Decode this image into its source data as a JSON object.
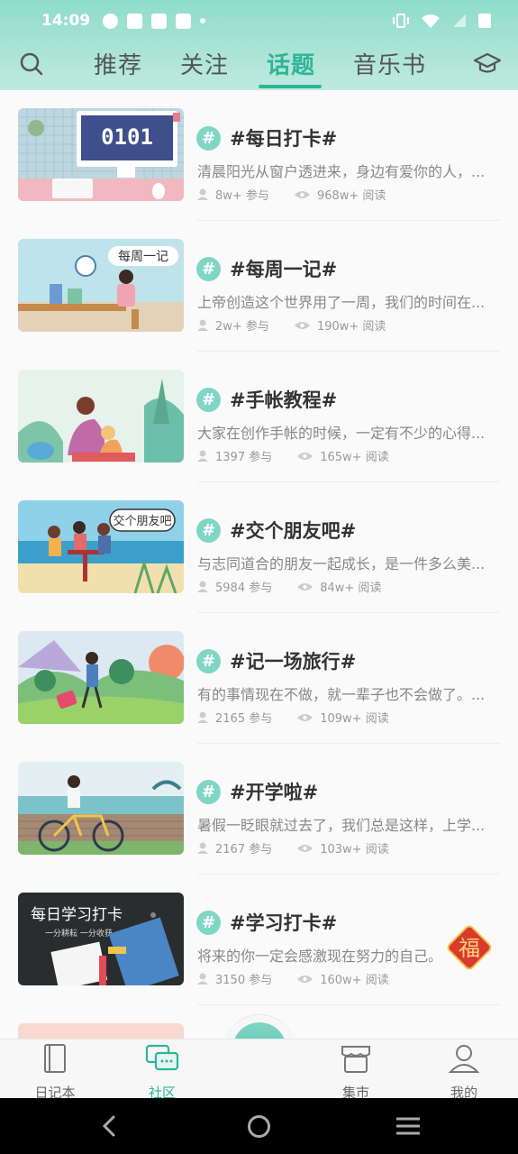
{
  "status": {
    "time": "14:09"
  },
  "nav": {
    "tabs": [
      {
        "label": "推荐"
      },
      {
        "label": "关注"
      },
      {
        "label": "话题"
      },
      {
        "label": "音乐书"
      }
    ]
  },
  "topics": [
    {
      "title": "#每日打卡#",
      "desc": "清晨阳光从窗户透进来，身边有爱你的人，...",
      "join": "8w+ 参与",
      "read": "968w+ 阅读"
    },
    {
      "title": "#每周一记#",
      "desc": "上帝创造这个世界用了一周，我们的时间在...",
      "join": "2w+ 参与",
      "read": "190w+ 阅读"
    },
    {
      "title": "#手帐教程#",
      "desc": "大家在创作手帐的时候，一定有不少的心得...",
      "join": "1397 参与",
      "read": "165w+ 阅读"
    },
    {
      "title": "#交个朋友吧#",
      "desc": "与志同道合的朋友一起成长，是一件多么美...",
      "join": "5984 参与",
      "read": "84w+ 阅读"
    },
    {
      "title": "#记一场旅行#",
      "desc": "有的事情现在不做，就一辈子也不会做了。...",
      "join": "2165 参与",
      "read": "109w+ 阅读"
    },
    {
      "title": "#开学啦#",
      "desc": "暑假一眨眼就过去了，我们总是这样，上学...",
      "join": "2167 参与",
      "read": "103w+ 阅读"
    },
    {
      "title": "#学习打卡#",
      "desc": "将来的你一定会感激现在努力的自己。",
      "join": "3150 参与",
      "read": "160w+ 阅读"
    }
  ],
  "thumb_text": {
    "t0": "0101",
    "t1": "每周一记",
    "t3": "交个朋友吧",
    "t6a": "每日学习打卡",
    "t6b": "一分耕耘 一分收获"
  },
  "fu": "福",
  "tabbar": {
    "diary": "日记本",
    "community": "社区",
    "market": "集市",
    "mine": "我的"
  },
  "colors": {
    "accent": "#2fb497",
    "header": "#8fdcc9",
    "badge": "#7fd6c3"
  }
}
